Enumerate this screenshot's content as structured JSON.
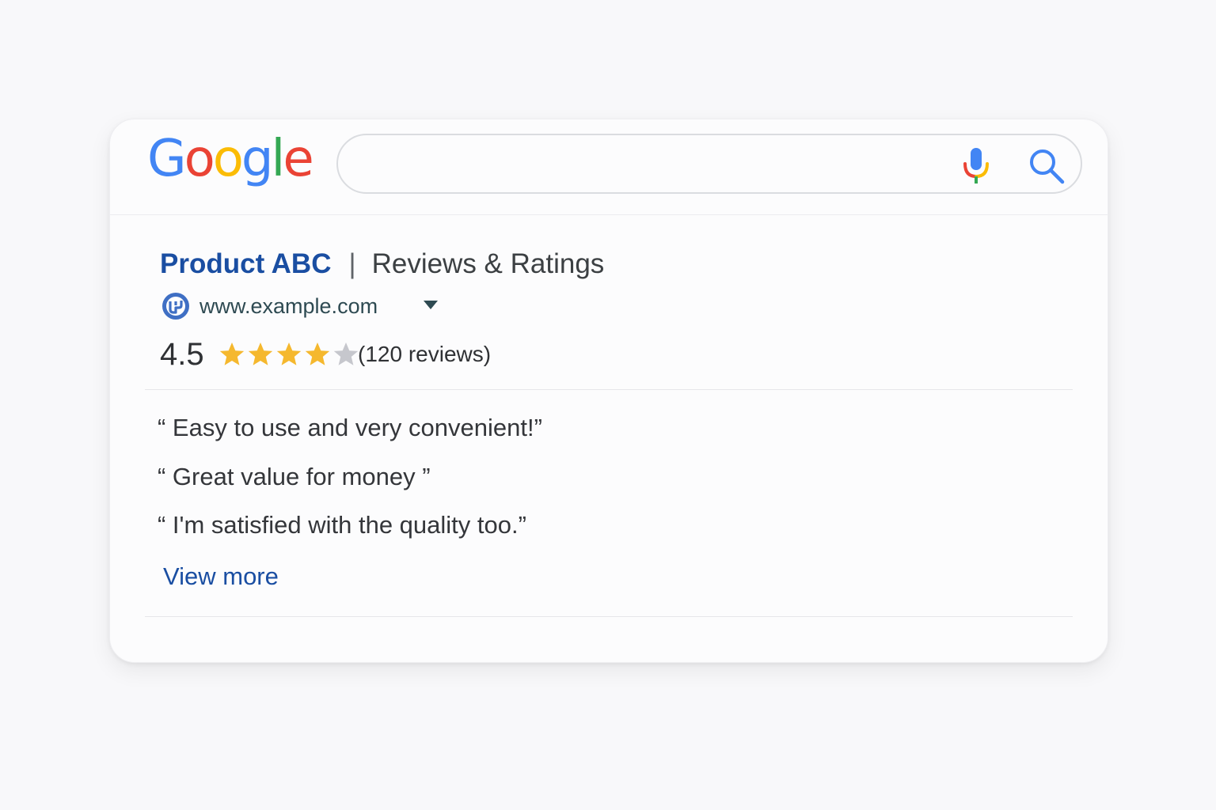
{
  "search": {
    "logo": [
      "G",
      "o",
      "o",
      "g",
      "l",
      "e"
    ],
    "logo_colors": [
      "#4285f4",
      "#ea4335",
      "#fbbc05",
      "#4285f4",
      "#34a853",
      "#ea4335"
    ],
    "query": "",
    "mic_icon": "microphone-icon",
    "search_icon": "magnifier-icon"
  },
  "result": {
    "title": "Product ABC",
    "separator": "|",
    "subtitle": "Reviews & Ratings",
    "favicon_icon": "site-favicon-icon",
    "url": "www.example.com",
    "url_menu_icon": "caret-down-icon",
    "rating": "4.5",
    "rating_value": 4.5,
    "rating_max": 5,
    "review_count": "(120 reviews)",
    "star_filled_color": "#f5b82e",
    "star_empty_color": "#c6c7cd"
  },
  "reviews": [
    "“ Easy to use and very convenient!”",
    "“ Great value for money ”",
    "“ I'm satisfied with the quality too.”"
  ],
  "view_more": "View more",
  "colors": {
    "link": "#1a4ea2",
    "text": "#34363a",
    "card_bg": "#fcfcfd",
    "page_bg": "#f8f8fa"
  }
}
